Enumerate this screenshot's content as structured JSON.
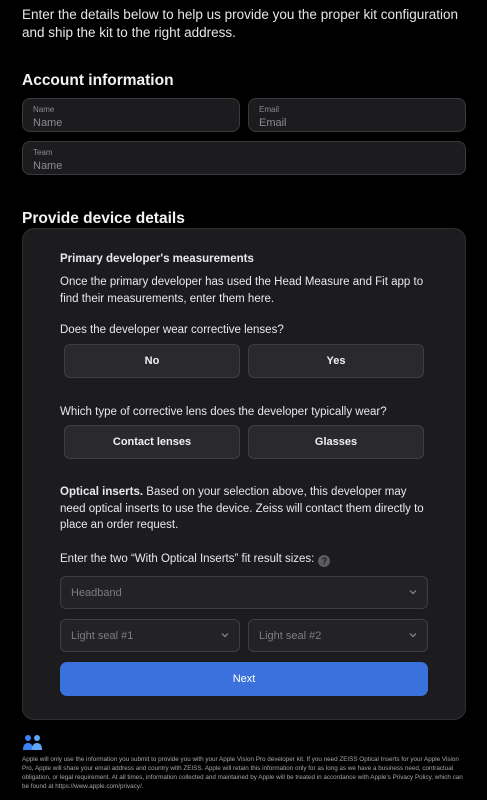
{
  "intro": "Enter the details below to help us provide you the proper kit configuration and ship the kit to the right address.",
  "account": {
    "title": "Account information",
    "name": {
      "label": "Name",
      "value": "Name"
    },
    "email": {
      "label": "Email",
      "value": "Email"
    },
    "team": {
      "label": "Team",
      "value": "Name"
    }
  },
  "device": {
    "title": "Provide device details",
    "subtitle": "Primary developer's measurements",
    "description": "Once the primary developer has used the Head Measure and Fit app to find their measurements, enter them here.",
    "q_lenses": "Does the developer wear corrective lenses?",
    "no_label": "No",
    "yes_label": "Yes",
    "q_type": "Which type of corrective lens does the developer typically wear?",
    "contacts_label": "Contact lenses",
    "glasses_label": "Glasses",
    "inserts_title": "Optical inserts.",
    "inserts_text": "Based on your selection above, this developer may need optical inserts to use the device. Zeiss will contact them directly to place an order request.",
    "fit_prompt": "Enter the two “With Optical Inserts” fit result sizes:",
    "help_glyph": "?",
    "headband_placeholder": "Headband",
    "lightseal1_placeholder": "Light seal #1",
    "lightseal2_placeholder": "Light seal #2",
    "next_label": "Next"
  },
  "footer": {
    "icon": "people-icon",
    "text": "Apple will only use the information you submit to provide you with your Apple Vision Pro developer kit. If you need ZEISS Optical Inserts for your Apple Vision Pro, Apple will share your email address and country with ZEISS. Apple will retain this information only for as long as we have a business need, contractual obligation, or legal requirement. At all times, information collected and maintained by Apple will be treated in accordance with Apple’s Privacy Policy, which can be found at https://www.apple.com/privacy/."
  },
  "colors": {
    "background": "#000000",
    "card": "#1c1c1f",
    "accent": "#3a71dd"
  }
}
